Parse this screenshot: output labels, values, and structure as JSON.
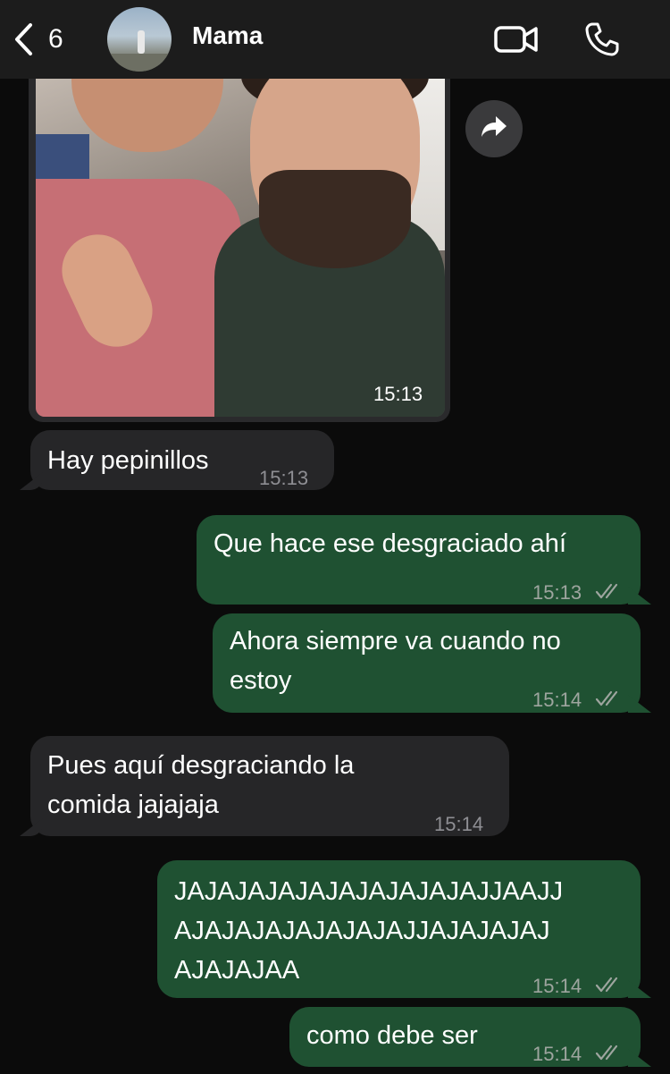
{
  "header": {
    "back_count": "6",
    "contact_name": "Mama",
    "icons": {
      "back": "chevron-left-icon",
      "video": "video-camera-icon",
      "phone": "phone-icon"
    }
  },
  "messages": {
    "photo": {
      "time": "15:13"
    },
    "m1": {
      "text": "Hay pepinillos",
      "time": "15:13",
      "direction": "incoming"
    },
    "m2": {
      "text": "Que hace ese desgraciado ahí",
      "time": "15:13",
      "direction": "outgoing"
    },
    "m3": {
      "text": "Ahora siempre va cuando no\nestoy",
      "time": "15:14",
      "direction": "outgoing"
    },
    "m4": {
      "text": "Pues aquí desgraciando la\ncomida jajajaja",
      "time": "15:14",
      "direction": "incoming"
    },
    "m5": {
      "text": "JAJAJAJAJAJAJAJAJAJAJJAAJJ\nAJAJAJAJAJAJAJAJJAJAJAJAJ\nAJAJAJAA",
      "time": "15:14",
      "direction": "outgoing"
    },
    "m6": {
      "text": "como debe ser",
      "time": "15:14",
      "direction": "outgoing"
    }
  },
  "colors": {
    "background": "#0b0b0b",
    "incoming_bubble": "#262628",
    "outgoing_bubble": "#1f5132",
    "header": "#1c1c1c"
  }
}
